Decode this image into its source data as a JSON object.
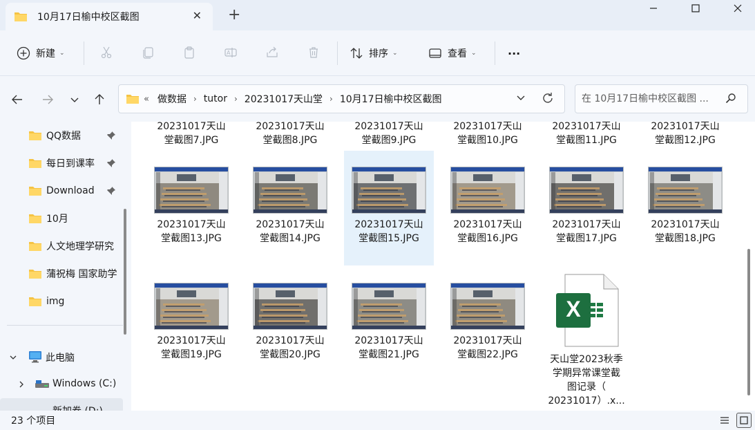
{
  "window": {
    "tab_title": "10月17日榆中校区截图",
    "tab_close": "✕",
    "new_tab": "+",
    "minimize": "—",
    "maximize": "☐",
    "close": "✕"
  },
  "toolbar": {
    "new_label": "新建",
    "sort_label": "排序",
    "view_label": "查看",
    "more_label": "···"
  },
  "address": {
    "overflow": "«",
    "crumbs": [
      "做数据",
      "tutor",
      "20231017天山堂",
      "10月17日榆中校区截图"
    ],
    "search_placeholder": "在 10月17日榆中校区截图 ..."
  },
  "sidebar": {
    "quick_access": [
      {
        "label": "QQ数据",
        "pinned": true
      },
      {
        "label": "每日到课率",
        "pinned": true
      },
      {
        "label": "Download",
        "pinned": true
      },
      {
        "label": "10月",
        "pinned": false
      },
      {
        "label": "人文地理学研究",
        "pinned": false
      },
      {
        "label": "蒲祝梅 国家助学",
        "pinned": false
      },
      {
        "label": "img",
        "pinned": false
      }
    ],
    "this_pc": "此电脑",
    "drive_c": "Windows (C:)",
    "drive_d": "新加卷 (D:)"
  },
  "files": {
    "row1": [
      {
        "l1": "20231017天山",
        "l2": "堂截图7.JPG"
      },
      {
        "l1": "20231017天山",
        "l2": "堂截图8.JPG"
      },
      {
        "l1": "20231017天山",
        "l2": "堂截图9.JPG"
      },
      {
        "l1": "20231017天山",
        "l2": "堂截图10.JPG"
      },
      {
        "l1": "20231017天山",
        "l2": "堂截图11.JPG"
      },
      {
        "l1": "20231017天山",
        "l2": "堂截图12.JPG"
      }
    ],
    "row2": [
      {
        "l1": "20231017天山",
        "l2": "堂截图13.JPG"
      },
      {
        "l1": "20231017天山",
        "l2": "堂截图14.JPG"
      },
      {
        "l1": "20231017天山",
        "l2": "堂截图15.JPG"
      },
      {
        "l1": "20231017天山",
        "l2": "堂截图16.JPG"
      },
      {
        "l1": "20231017天山",
        "l2": "堂截图17.JPG"
      },
      {
        "l1": "20231017天山",
        "l2": "堂截图18.JPG"
      }
    ],
    "row3": [
      {
        "l1": "20231017天山",
        "l2": "堂截图19.JPG"
      },
      {
        "l1": "20231017天山",
        "l2": "堂截图20.JPG"
      },
      {
        "l1": "20231017天山",
        "l2": "堂截图21.JPG"
      },
      {
        "l1": "20231017天山",
        "l2": "堂截图22.JPG"
      }
    ],
    "excel": {
      "l1": "天山堂2023秋季",
      "l2": "学期异常课堂截",
      "l3": "图记录（",
      "l4": "20231017）.x..."
    },
    "selected": "堂截图15.JPG"
  },
  "status": {
    "count": "23 个项目"
  },
  "colors": {
    "accent": "#0067c0",
    "folder": "#f5c344",
    "excel": "#1f7a44",
    "selection": "#e5f1fb"
  }
}
